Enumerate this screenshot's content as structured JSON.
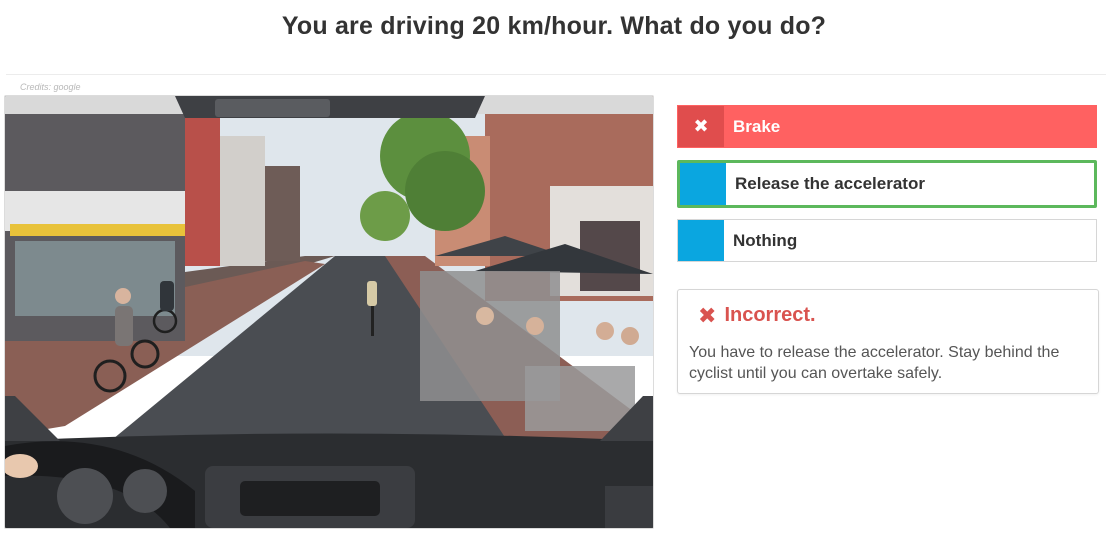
{
  "question": "You are driving 20 km/hour. What do you do?",
  "credits": "Credits: google",
  "options": [
    {
      "label": "Brake",
      "state": "wrong",
      "icon": "cross-icon"
    },
    {
      "label": "Release the accelerator",
      "state": "correct",
      "icon": ""
    },
    {
      "label": "Nothing",
      "state": "neutral",
      "icon": ""
    }
  ],
  "feedback": {
    "title": "Incorrect.",
    "icon": "cross-icon",
    "message": "You have to release the accelerator. Stay behind the cyclist until you can overtake safely."
  },
  "colors": {
    "wrong": "#ff6161",
    "correct_border": "#5cb85c",
    "marker_blue": "#0aa6e0",
    "error_text": "#d9534f"
  }
}
